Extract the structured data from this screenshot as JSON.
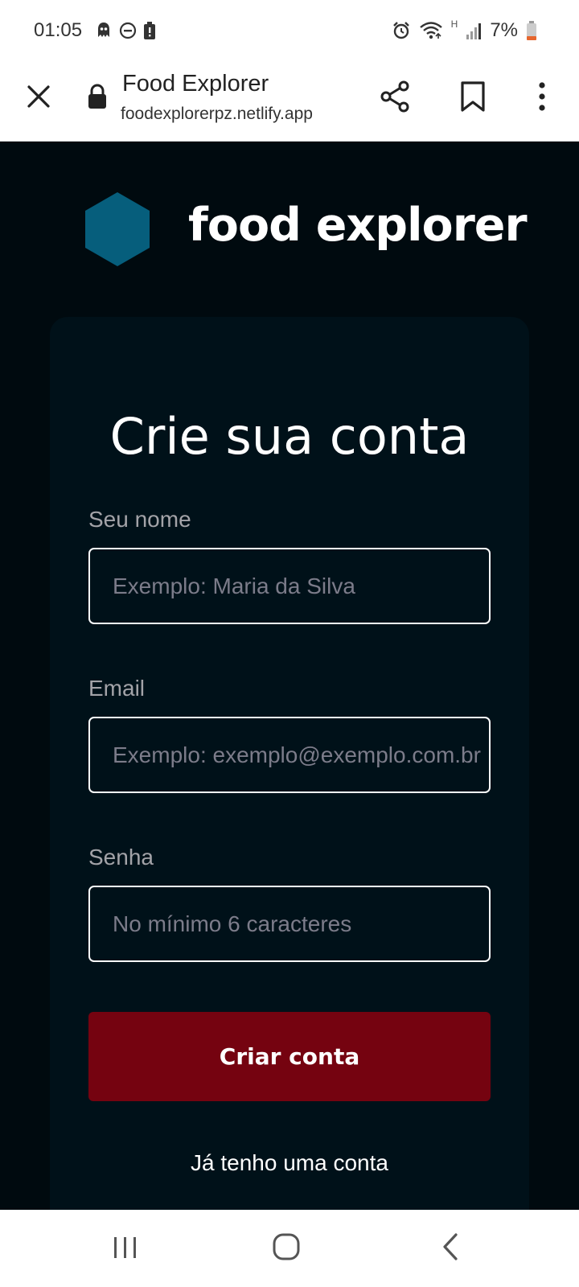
{
  "status_bar": {
    "time": "01:05",
    "battery": "7%",
    "network_type": "H",
    "icons": [
      "ghost-icon",
      "do-not-disturb-icon",
      "battery-saver-icon",
      "alarm-icon",
      "wifi-icon",
      "signal-icon",
      "battery-icon"
    ]
  },
  "browser": {
    "page_title": "Food Explorer",
    "url": "foodexplorerpz.netlify.app",
    "icons": [
      "close-icon",
      "lock-icon",
      "share-icon",
      "bookmark-icon",
      "more-vert-icon"
    ]
  },
  "app": {
    "logo_text": "food explorer",
    "logo_color": "#065E7C",
    "form": {
      "title": "Crie sua conta",
      "fields": [
        {
          "label": "Seu nome",
          "placeholder": "Exemplo: Maria da Silva",
          "value": ""
        },
        {
          "label": "Email",
          "placeholder": "Exemplo: exemplo@exemplo.com.br",
          "value": ""
        },
        {
          "label": "Senha",
          "placeholder": "No mínimo 6 caracteres",
          "value": ""
        }
      ],
      "submit_label": "Criar conta",
      "login_link": "Já tenho uma conta"
    },
    "colors": {
      "background": "#000A0F",
      "card": "#001119",
      "button": "#750310"
    }
  },
  "navbar": {
    "icons": [
      "recents-icon",
      "home-icon",
      "back-icon"
    ]
  }
}
